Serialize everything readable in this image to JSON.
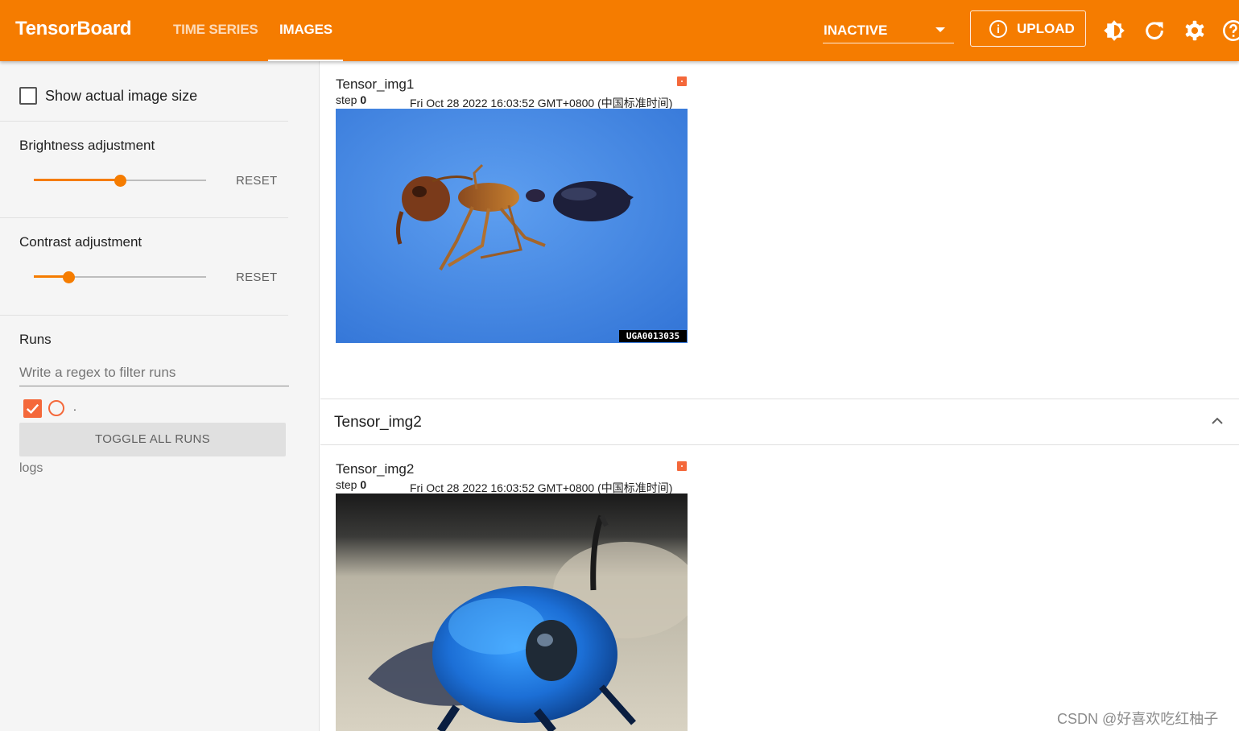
{
  "header": {
    "brand": "TensorBoard",
    "tabs": [
      {
        "label": "TIME SERIES",
        "active": false
      },
      {
        "label": "IMAGES",
        "active": true
      }
    ],
    "run_selector": "INACTIVE",
    "upload_label": "UPLOAD",
    "icons": [
      "brightness-icon",
      "refresh-icon",
      "settings-icon",
      "help-icon"
    ],
    "accent_color": "#f57c00"
  },
  "sidebar": {
    "show_actual_size_label": "Show actual image size",
    "show_actual_size_checked": false,
    "brightness": {
      "label": "Brightness adjustment",
      "value": 0.5,
      "reset_label": "RESET"
    },
    "contrast": {
      "label": "Contrast adjustment",
      "value": 0.2,
      "reset_label": "RESET"
    },
    "runs": {
      "title": "Runs",
      "filter_placeholder": "Write a regex to filter runs",
      "items": [
        {
          "name": ".",
          "checked": true,
          "color": "#f4683a"
        }
      ],
      "toggle_all_label": "TOGGLE ALL RUNS",
      "group_label": "logs"
    }
  },
  "main": {
    "cards": [
      {
        "title": "Tensor_img1",
        "step_label": "step",
        "step": "0",
        "timestamp": "Fri Oct 28 2022 16:03:52 GMT+0800 (中国标准时间)",
        "image_tag": "UGA0013035",
        "image_subject": "ant"
      },
      {
        "title": "Tensor_img2",
        "step_label": "step",
        "step": "0",
        "timestamp": "Fri Oct 28 2022 16:03:52 GMT+0800 (中国标准时间)",
        "image_subject": "bee"
      }
    ],
    "group_title": "Tensor_img2"
  },
  "watermark": "CSDN @好喜欢吃红柚子"
}
